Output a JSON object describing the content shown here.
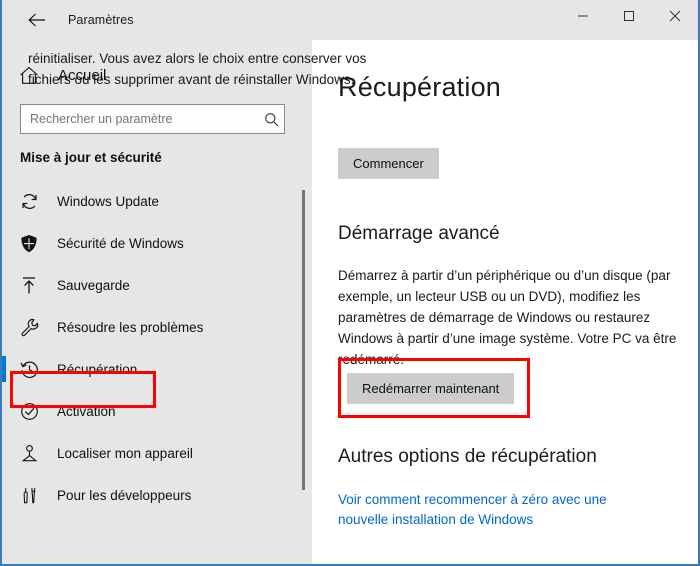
{
  "window": {
    "title": "Paramètres",
    "accent_border_color": "#3a7cb5",
    "titlebar_bg": "#e6e6e6",
    "controls": {
      "back": "back-arrow-icon",
      "minimize": "minimize-icon",
      "maximize": "maximize-icon",
      "close": "close-icon"
    }
  },
  "sidebar": {
    "home_label": "Accueil",
    "home_icon": "home-icon",
    "search": {
      "value": "",
      "placeholder": "Rechercher un paramètre",
      "icon": "search-icon"
    },
    "section_heading": "Mise à jour et sécurité",
    "items": [
      {
        "label": "Windows Update",
        "icon": "sync-arrows-icon",
        "selected": false
      },
      {
        "label": "Sécurité de Windows",
        "icon": "shield-icon",
        "selected": false
      },
      {
        "label": "Sauvegarde",
        "icon": "upload-arrow-icon",
        "selected": false
      },
      {
        "label": "Résoudre les problèmes",
        "icon": "wrench-icon",
        "selected": false
      },
      {
        "label": "Récupération",
        "icon": "history-clock-icon",
        "selected": true
      },
      {
        "label": "Activation",
        "icon": "check-circle-icon",
        "selected": false
      },
      {
        "label": "Localiser mon appareil",
        "icon": "locate-device-icon",
        "selected": false
      },
      {
        "label": "Pour les développeurs",
        "icon": "developer-tools-icon",
        "selected": false
      }
    ],
    "scrollbar": "vertical-scrollbar"
  },
  "content": {
    "page_title": "Récupération",
    "reset_section": {
      "description": "réinitialiser. Vous avez alors le choix entre conserver vos fichiers ou les supprimer avant de réinstaller Windows.",
      "button_label": "Commencer"
    },
    "advanced_startup": {
      "heading": "Démarrage avancé",
      "description": "Démarrez à partir d’un périphérique ou d’un disque (par exemple, un lecteur USB ou un DVD), modifiez les paramètres de démarrage de Windows ou restaurez Windows à partir d’une image système. Votre PC va être redémarré.",
      "button_label": "Redémarrer maintenant"
    },
    "other_options": {
      "heading": "Autres options de récupération",
      "link_text": "Voir comment recommencer à zéro avec une nouvelle installation de Windows",
      "link_color": "#0066cc"
    }
  },
  "annotations": {
    "color": "#ff0000",
    "boxes": [
      {
        "name": "recovery-sidebar-highlight",
        "target": "Récupération"
      },
      {
        "name": "restart-now-highlight",
        "target": "Redémarrer maintenant"
      }
    ]
  }
}
